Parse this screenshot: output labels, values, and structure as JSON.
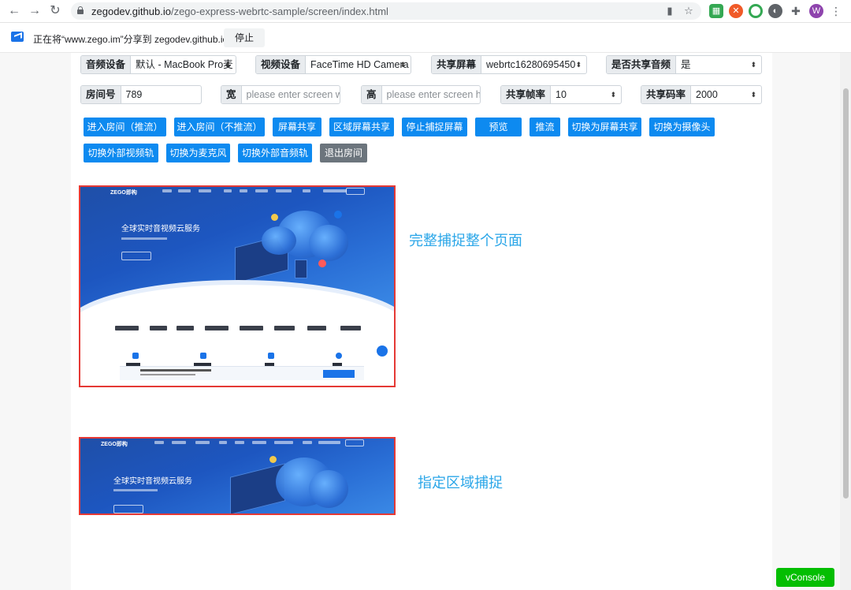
{
  "browser": {
    "url_host": "zegodev.github.io",
    "url_path": "/zego-express-webrtc-sample/screen/index.html",
    "profile_initial": "W"
  },
  "sharebar": {
    "message": "正在将“www.zego.im”分享到 zegodev.github.io",
    "stop_label": "停止"
  },
  "controls": {
    "audio_device_label": "音频设备",
    "audio_device_value": "默认 - MacBook Pro麦",
    "video_device_label": "视频设备",
    "video_device_value": "FaceTime HD Camera",
    "share_screen_label": "共享屏幕",
    "share_screen_value": "webrtc16280695450",
    "share_audio_label": "是否共享音频",
    "share_audio_value": "是",
    "room_label": "房间号",
    "room_value": "789",
    "width_label": "宽",
    "width_placeholder": "please enter screen width",
    "height_label": "高",
    "height_placeholder": "please enter screen height",
    "fps_label": "共享帧率",
    "fps_value": "10",
    "bitrate_label": "共享码率",
    "bitrate_value": "2000"
  },
  "buttons": {
    "login_publish": "进入房间（推流）",
    "login_no_publish": "进入房间（不推流）",
    "screen_share": "屏幕共享",
    "region_share": "区域屏幕共享",
    "stop_capture": "停止捕捉屏幕",
    "preview": "预览",
    "publish": "推流",
    "switch_screen": "切换为屏幕共享",
    "switch_camera": "切换为摄像头",
    "switch_ext_video": "切换外部视频轨",
    "switch_mic": "切换为麦克风",
    "switch_ext_audio": "切换外部音频轨",
    "logout": "退出房间"
  },
  "previews": {
    "full_caption": "完整捕捉整个页面",
    "region_caption": "指定区域捕捉",
    "shot_logo": "ZEGO即构",
    "shot_headline": "全球实时音视频云服务"
  },
  "vconsole_label": "vConsole",
  "colors": {
    "primary_button": "#0d8af0",
    "secondary_button": "#6c757d",
    "preview_border": "#e53935",
    "caption": "#2aa6e8",
    "vconsole": "#04be02"
  }
}
